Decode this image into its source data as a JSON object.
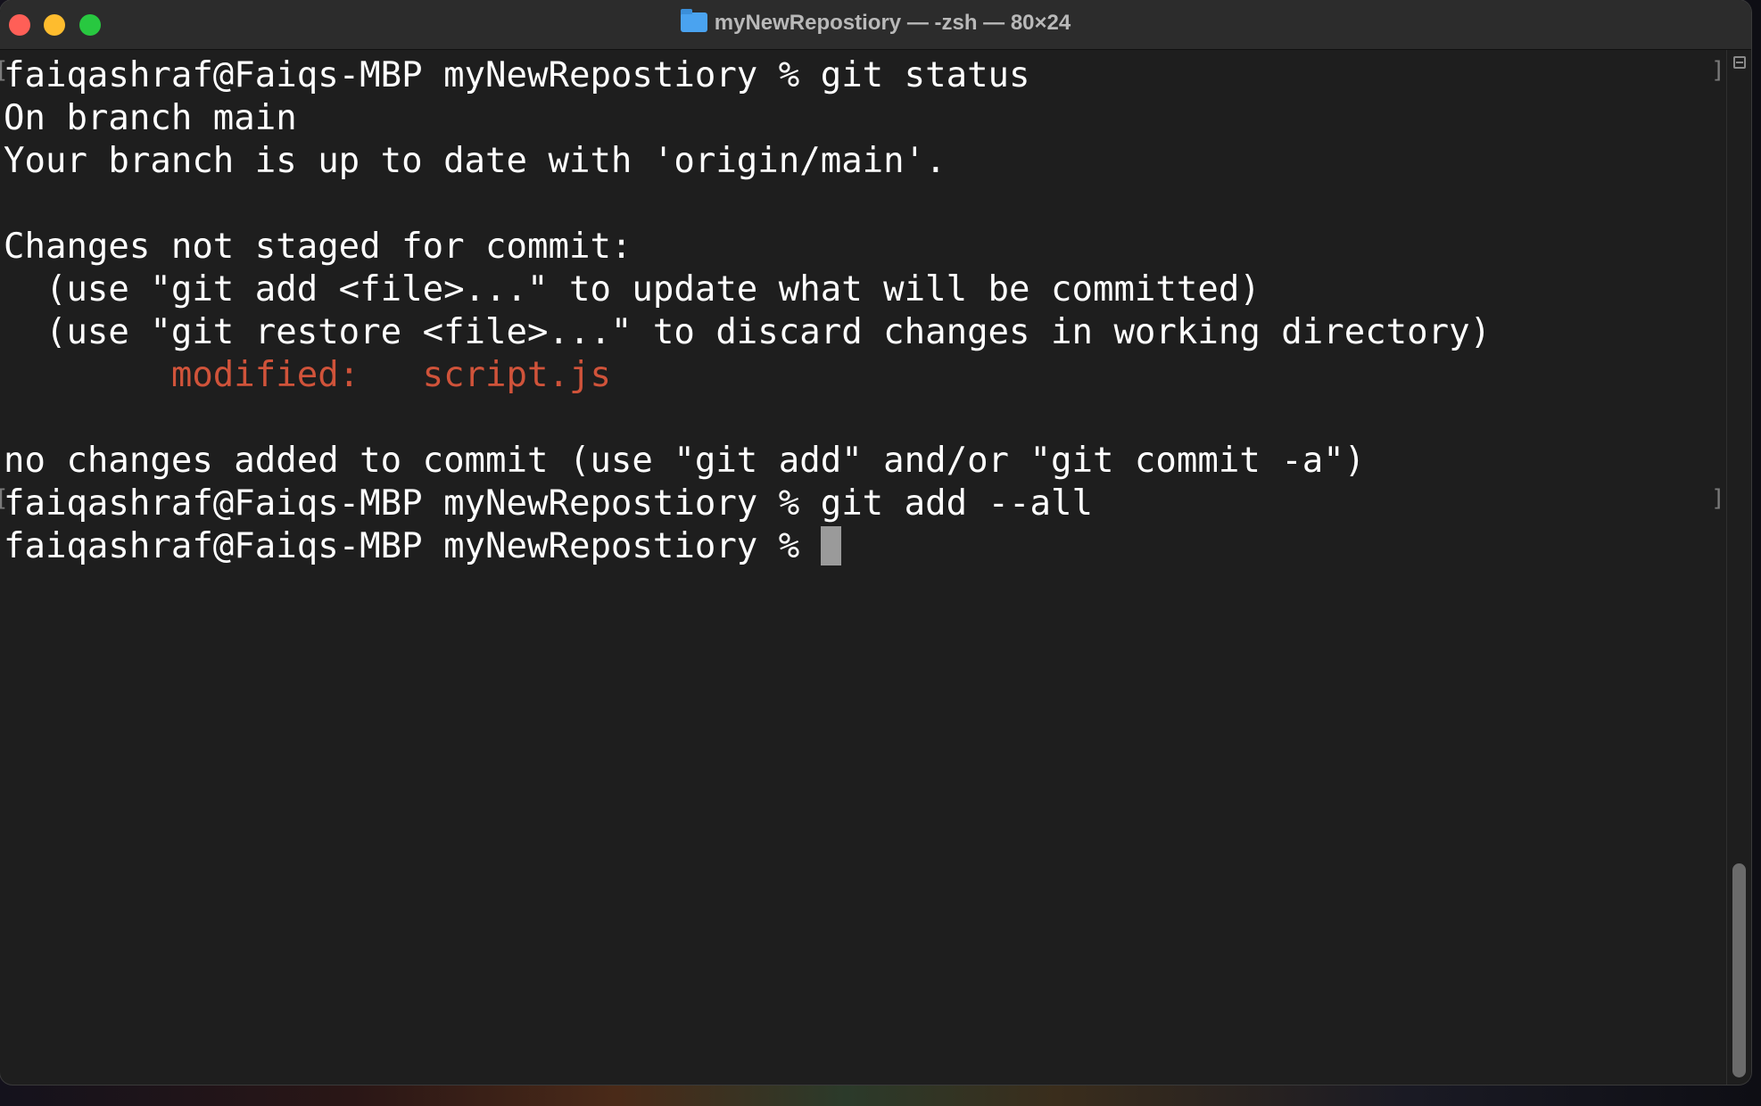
{
  "window": {
    "title": "myNewRepostiory — -zsh — 80×24",
    "folder_icon": "folder-icon"
  },
  "colors": {
    "background": "#1e1e1e",
    "text": "#ffffff",
    "modified": "#d0533a",
    "titlebar": "#2c2c2c"
  },
  "terminal": {
    "lines": [
      "faiqashraf@Faiqs-MBP myNewRepostiory % git status",
      "On branch main",
      "Your branch is up to date with 'origin/main'.",
      "",
      "Changes not staged for commit:",
      "  (use \"git add <file>...\" to update what will be committed)",
      "  (use \"git restore <file>...\" to discard changes in working directory)",
      "        modified:   script.js",
      "",
      "no changes added to commit (use \"git add\" and/or \"git commit -a\")",
      "faiqashraf@Faiqs-MBP myNewRepostiory % git add --all",
      "faiqashraf@Faiqs-MBP myNewRepostiory % "
    ]
  }
}
